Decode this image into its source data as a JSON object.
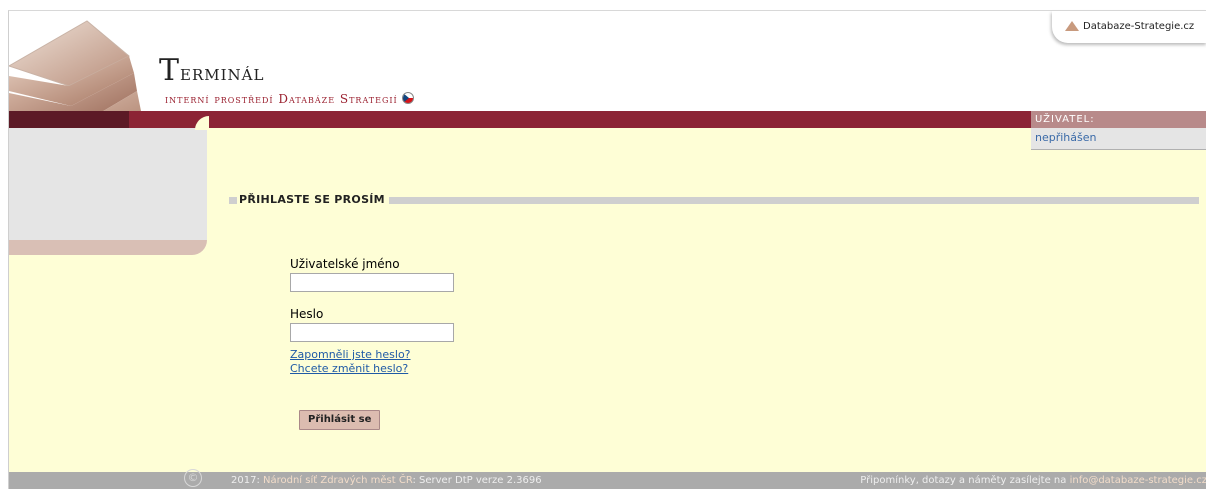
{
  "header": {
    "title_first_letter": "T",
    "title_rest": "erminál",
    "subtitle": "interní prostředí Databáze Strategií",
    "db_tab_label": "Databaze-Strategie.cz"
  },
  "user_box": {
    "heading": "UŽIVATEL:",
    "status": "nepřihášen"
  },
  "login": {
    "section_title": "PŘIHLASTE SE PROSÍM",
    "username_label": "Uživatelské jméno",
    "username_value": "",
    "password_label": "Heslo",
    "password_value": "",
    "forgot_link": "Zapomněli jste heslo?",
    "change_link": "Chcete změnit heslo?",
    "submit_label": "Přihlásit se"
  },
  "footer": {
    "copyright_symbol": "©",
    "year_prefix": "2017: ",
    "org_link": "Národní síť Zdravých měst ČR",
    "server_info": ": Server DtP verze 2.3696",
    "contact_text": "Připomínky, dotazy a náměty zasílejte na ",
    "contact_email": "info@databaze-strategie.cz"
  },
  "colors": {
    "header_bar": "#8c2435",
    "content_bg": "#fefed6",
    "link": "#1f5aa6",
    "footer_bg": "#ababab"
  }
}
